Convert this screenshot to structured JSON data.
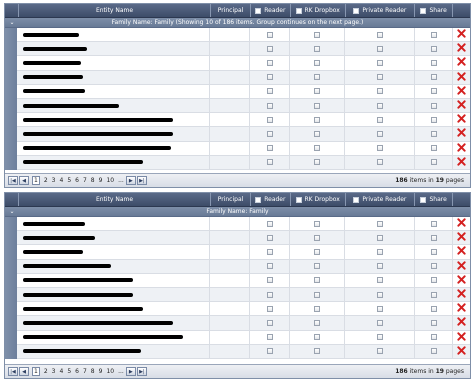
{
  "columns": {
    "entity": "Entity Name",
    "principal": "Principal",
    "reader": "Reader",
    "rk_dropbox": "RK Dropbox",
    "private_reader": "Private Reader",
    "share": "Share"
  },
  "grid1": {
    "group_label": "Family Name: Family (Showing 10 of 186 items. Group continues on the next page.)",
    "rows": 10,
    "pager": {
      "pages": [
        "1",
        "2",
        "3",
        "4",
        "5",
        "6",
        "7",
        "8",
        "9",
        "10",
        "..."
      ],
      "current": "1",
      "items_count": "186",
      "items_text": " items in ",
      "pages_count": "19",
      "pages_text": " pages"
    }
  },
  "grid2": {
    "group_label": "Family Name: Family",
    "rows": 10,
    "pager": {
      "pages": [
        "1",
        "2",
        "3",
        "4",
        "5",
        "6",
        "7",
        "8",
        "9",
        "10",
        "..."
      ],
      "current": "1",
      "items_count": "186",
      "items_text": " items in ",
      "pages_count": "19",
      "pages_text": " pages"
    }
  },
  "icons": {
    "expand": "chevron-down-icon",
    "delete": "delete-x-icon",
    "first": "first-page-icon",
    "prev": "prev-page-icon",
    "next": "next-page-icon",
    "last": "last-page-icon"
  },
  "colors": {
    "header": "#3d4c68",
    "group": "#687a96",
    "delete": "#d42020"
  }
}
